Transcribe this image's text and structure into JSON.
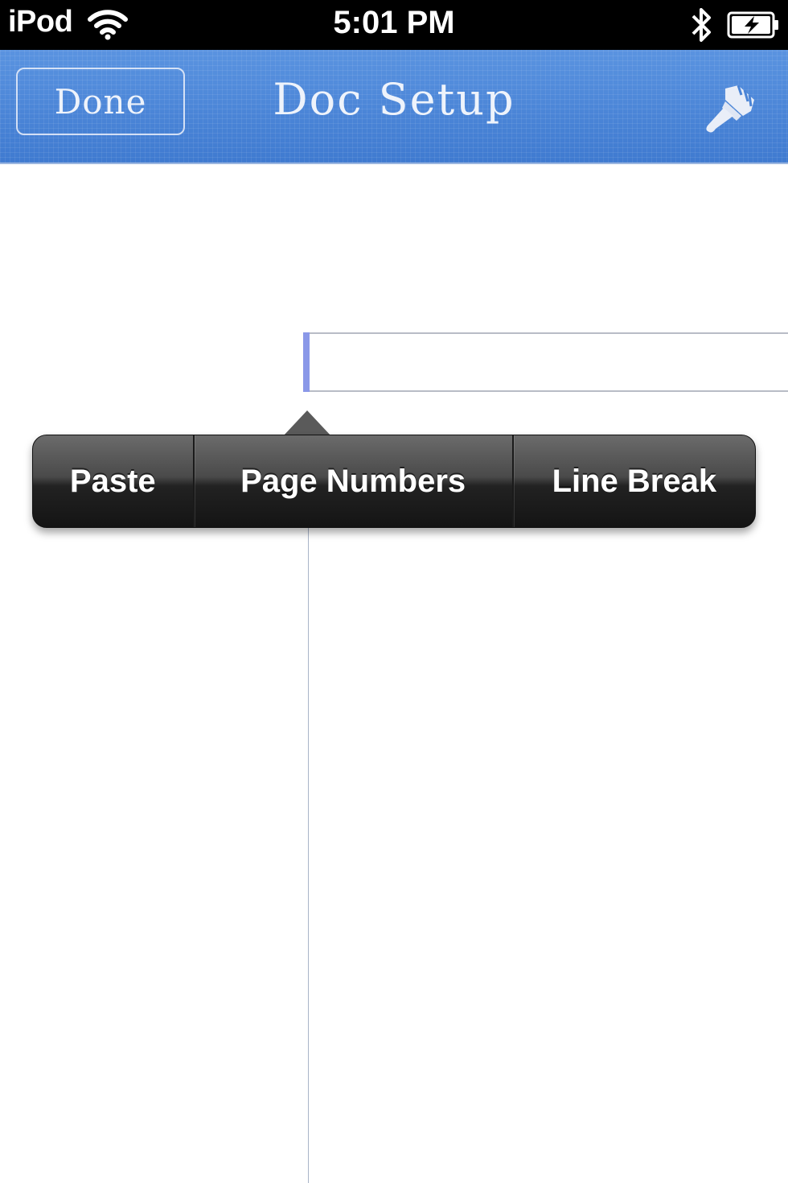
{
  "status_bar": {
    "device": "iPod",
    "time": "5:01 PM",
    "icons": [
      "wifi-icon",
      "bluetooth-icon",
      "battery-charging-icon"
    ]
  },
  "nav_bar": {
    "done_label": "Done",
    "title": "Doc Setup",
    "right_icon": "paint-brush-icon",
    "background_color": "#4a84d6"
  },
  "edit_menu": {
    "items": [
      {
        "label": "Paste"
      },
      {
        "label": "Page Numbers"
      },
      {
        "label": "Line Break"
      }
    ]
  },
  "colors": {
    "caret": "#8a98e8",
    "margin_line": "#a9b4c8"
  }
}
